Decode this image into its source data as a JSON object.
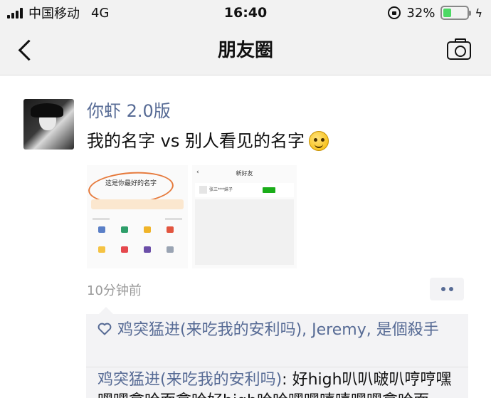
{
  "status_bar": {
    "carrier": "中国移动",
    "network": "4G",
    "time": "16:40",
    "battery_percent": "32%",
    "battery_level": 0.32,
    "icons": [
      "signal-icon",
      "rotation-lock-icon",
      "battery-icon",
      "charging-icon"
    ]
  },
  "nav": {
    "title": "朋友圈",
    "icons": [
      "back-chevron-icon",
      "camera-icon"
    ]
  },
  "post": {
    "username": "你虾 2.0版",
    "content": "我的名字 vs 别人看见的名字",
    "time": "10分钟前",
    "likes": "鸡突猛进(来吃我的安利吗), Jeremy, 是個殺手",
    "comment_author": "鸡突猛进(来吃我的安利吗)",
    "comment_text": ": 好high叭叭啵叭哼哼嘿嘿嘿拿哈面拿哈好high哈哈嘿嘿嘻嘻嘿嘿拿哈面",
    "thumb1_text": "这是你最好的名字",
    "thumb2_title": "新好友",
    "thumb2_name": "张三***妹子"
  },
  "colors": {
    "link": "#576b95",
    "background_bar": "#f2f2f2",
    "comment_bg": "#f3f3f5",
    "battery": "#4cd964"
  }
}
